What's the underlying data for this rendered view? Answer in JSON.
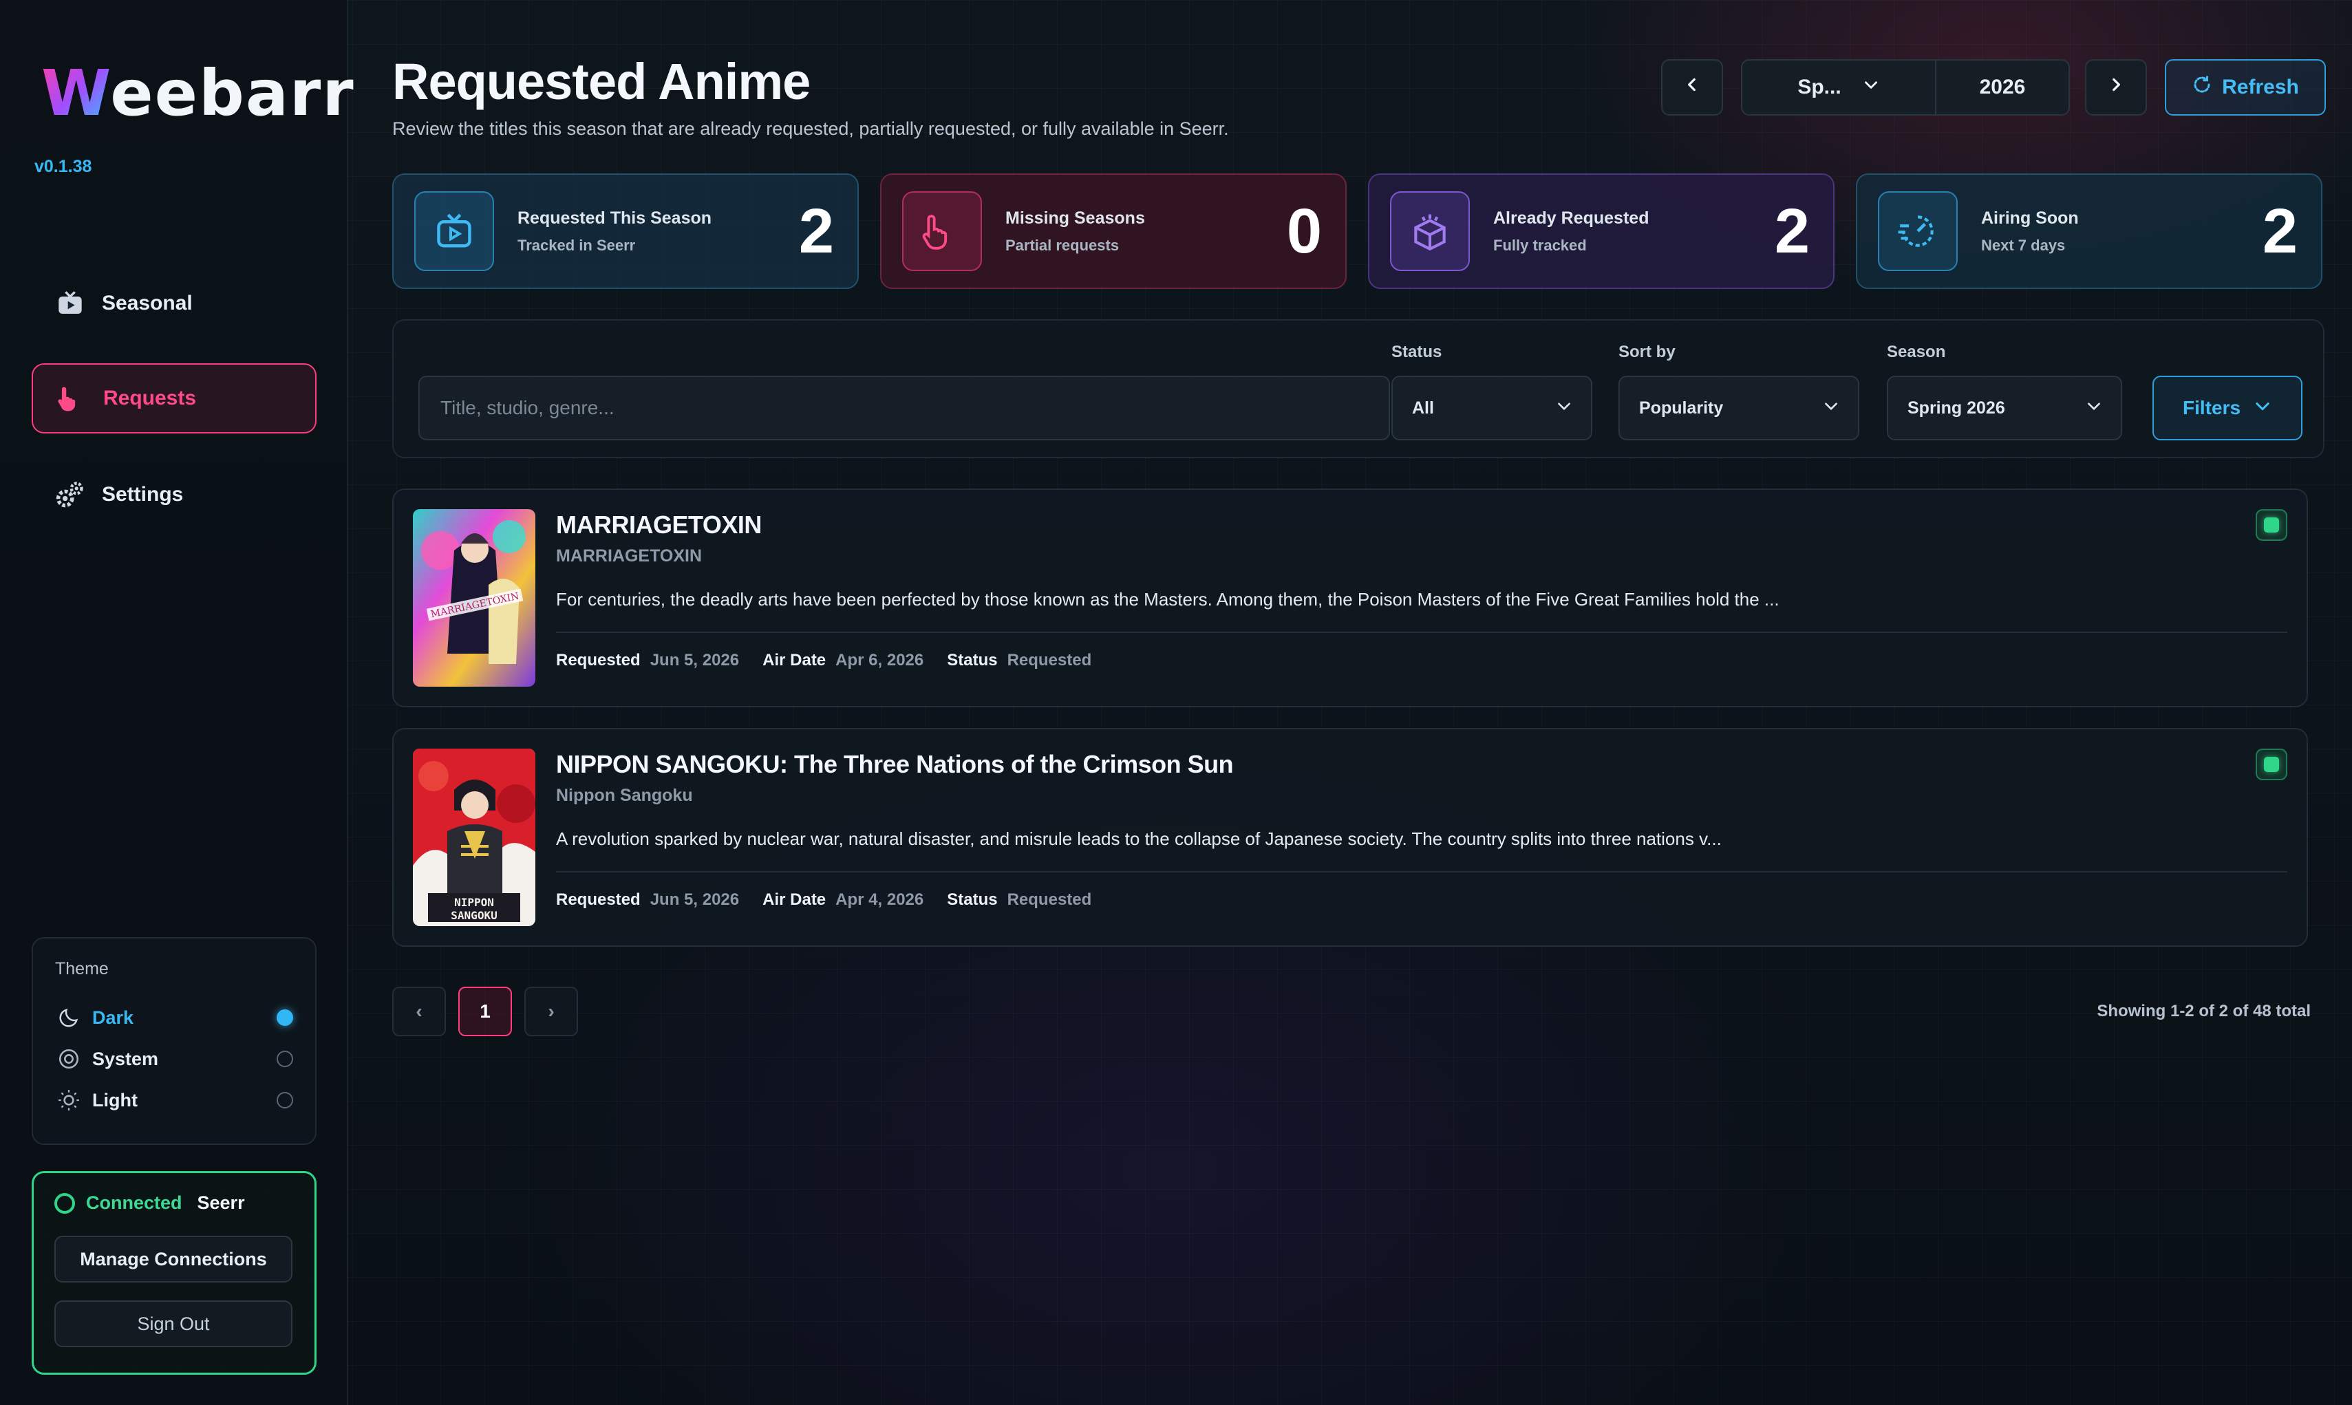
{
  "app": {
    "logo_first": "W",
    "logo_rest": "eebarr",
    "version": "v0.1.38"
  },
  "sidebar": {
    "items": [
      {
        "label": "Seasonal",
        "icon": "tv-icon"
      },
      {
        "label": "Requests",
        "icon": "pointer-hand-icon",
        "active": true
      },
      {
        "label": "Settings",
        "icon": "gears-icon"
      }
    ],
    "theme": {
      "title": "Theme",
      "options": [
        {
          "label": "Dark",
          "icon": "moon-icon",
          "selected": true
        },
        {
          "label": "System",
          "icon": "system-icon",
          "selected": false
        },
        {
          "label": "Light",
          "icon": "sun-icon",
          "selected": false
        }
      ]
    },
    "connection": {
      "status": "Connected",
      "service": "Seerr",
      "manage_label": "Manage Connections",
      "signout_label": "Sign Out"
    }
  },
  "header": {
    "title": "Requested Anime",
    "subtitle": "Review the titles this season that are already requested, partially requested, or fully available in Seerr.",
    "season_short": "Sp...",
    "year": "2026",
    "refresh_label": "Refresh"
  },
  "stats": [
    {
      "title": "Requested This Season",
      "subtitle": "Tracked in Seerr",
      "value": "2",
      "icon": "tv-icon"
    },
    {
      "title": "Missing Seasons",
      "subtitle": "Partial requests",
      "value": "0",
      "icon": "pointer-hand-icon"
    },
    {
      "title": "Already Requested",
      "subtitle": "Fully tracked",
      "value": "2",
      "icon": "box-icon"
    },
    {
      "title": "Airing Soon",
      "subtitle": "Next 7 days",
      "value": "2",
      "icon": "speed-icon"
    }
  ],
  "filters": {
    "search_placeholder": "Title, studio, genre...",
    "status_label": "Status",
    "status_value": "All",
    "sort_label": "Sort by",
    "sort_value": "Popularity",
    "season_label": "Season",
    "season_value": "Spring 2026",
    "filters_button": "Filters"
  },
  "results": [
    {
      "title": "MARRIAGETOXIN",
      "alt_title": "MARRIAGETOXIN",
      "description": "For centuries, the deadly arts have been perfected by those known as the Masters. Among them, the Poison Masters of the Five Great Families hold the ...",
      "requested_label": "Requested",
      "requested": "Jun 5, 2026",
      "air_label": "Air Date",
      "air_date": "Apr 6, 2026",
      "status_label": "Status",
      "status": "Requested"
    },
    {
      "title": "NIPPON SANGOKU: The Three Nations of the Crimson Sun",
      "alt_title": "Nippon Sangoku",
      "description": "A revolution sparked by nuclear war, natural disaster, and misrule leads to the collapse of Japanese society. The country splits into three nations v...",
      "requested_label": "Requested",
      "requested": "Jun 5, 2026",
      "air_label": "Air Date",
      "air_date": "Apr 4, 2026",
      "status_label": "Status",
      "status": "Requested"
    }
  ],
  "pagination": {
    "prev": "‹",
    "current": "1",
    "next": "›",
    "summary": "Showing 1-2 of 2 of 48 total"
  },
  "colors": {
    "accent_blue": "#43bdf5",
    "accent_pink": "#ff3c7d",
    "accent_green": "#2fd68a",
    "background": "#0b1117"
  }
}
